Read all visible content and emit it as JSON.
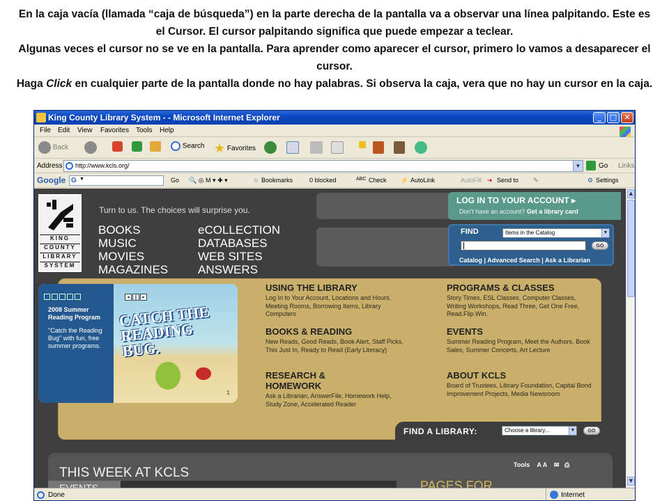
{
  "instructions": {
    "p1": "En la caja vacía (llamada “caja de búsqueda”) en la parte  derecha de la pantalla va a observar una línea palpitando.  Este es el Cursor. El cursor palpitando  significa que puede empezar a teclear.",
    "p2": "Algunas veces el cursor no se ve en la pantalla. Para aprender como aparecer el cursor, primero lo vamos a desaparecer el cursor.",
    "p3_pre": "Haga ",
    "p3_em": "Click",
    "p3_post": " en cualquier parte de la pantalla donde no hay palabras. Si observa la caja, vera que no hay un cursor en la caja."
  },
  "window": {
    "title": "King County Library System - - Microsoft Internet Explorer",
    "menu": [
      "File",
      "Edit",
      "View",
      "Favorites",
      "Tools",
      "Help"
    ],
    "toolbar": {
      "back": "Back",
      "search": "Search",
      "favorites": "Favorites"
    },
    "address": {
      "label": "Address",
      "url": "http://www.kcls.org/",
      "go": "Go",
      "links": "Links"
    },
    "google": {
      "label": "Google",
      "go": "Go",
      "bookmarks": "Bookmarks",
      "blocked": "0 blocked",
      "check": "Check",
      "autolink": "AutoLink",
      "autofill": "AutoFill",
      "sendto": "Send to",
      "settings": "Settings"
    },
    "status": {
      "left": "Done",
      "zone": "Internet"
    }
  },
  "site": {
    "logo": [
      "KING",
      "COUNTY",
      "LIBRARY",
      "SYSTEM"
    ],
    "tagline": "Turn to us. The choices will surprise you.",
    "nav_left": [
      "BOOKS",
      "MUSIC",
      "MOVIES",
      "MAGAZINES"
    ],
    "nav_right": [
      "eCOLLECTION",
      "DATABASES",
      "WEB SITES",
      "ANSWERS"
    ],
    "account": {
      "heading": "LOG IN TO YOUR ACCOUNT",
      "sub_pre": "Don't have an account?",
      "sub_link": "Get a library card"
    },
    "find": {
      "label": "FIND",
      "scope": "Items in the Catalog",
      "go": "GO",
      "links": [
        "Catalog",
        "Advanced Search",
        "Ask a Librarian"
      ]
    },
    "feature": {
      "heading": "2008 Summer Reading Program",
      "quote": "\"Catch the Reading Bug\" with fun, free summer programs.",
      "art_title": "CATCH THE READING BUG.",
      "page": "1"
    },
    "sections": [
      {
        "title": "USING THE LIBRARY",
        "body": "Log In to Your Account, Locations and Hours, Meeting Rooms, Borrowing Items, Library Computers"
      },
      {
        "title": "BOOKS & READING",
        "body": "New Reads, Good Reads, Book Alert, Staff Picks, This Just In, Ready to Read (Early Literacy)"
      },
      {
        "title": "RESEARCH & HOMEWORK",
        "body": "Ask a Librarian, AnswerFile, Homework Help, Study Zone, Accelerated Reader"
      },
      {
        "title": "PROGRAMS & CLASSES",
        "body": "Story Times, ESL Classes, Computer Classes, Writing Workshops, Read Three, Get One Free, Read.Flip.Win."
      },
      {
        "title": "EVENTS",
        "body": "Summer Reading Program, Meet the Authors, Book Sales, Summer Concerts, Art Lecture"
      },
      {
        "title": "ABOUT KCLS",
        "body": "Board of Trustees, Library Foundation, Capital Bond Improvement Projects, Media Newsroom"
      }
    ],
    "find_library": {
      "label": "FIND A LIBRARY:",
      "select": "Choose a library...",
      "go": "GO"
    },
    "this_week": {
      "heading": "THIS WEEK AT KCLS",
      "tools": "Tools",
      "font": "A A",
      "events": "EVENTS",
      "pages": "PAGES FOR"
    }
  }
}
